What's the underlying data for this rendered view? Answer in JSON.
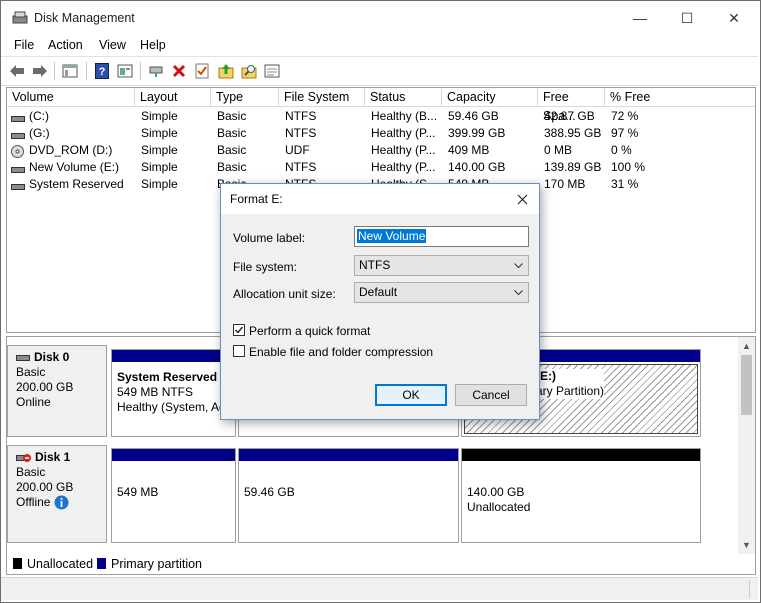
{
  "window": {
    "title": "Disk Management",
    "controls": {
      "minimize": "—",
      "maximize": "☐",
      "close": "✕"
    }
  },
  "menu": [
    "File",
    "Action",
    "View",
    "Help"
  ],
  "toolbar": {
    "icons": [
      "back-icon",
      "forward-icon",
      "console-tree-icon",
      "help-icon",
      "properties-icon",
      "connect-icon",
      "delete-icon",
      "check-icon",
      "open-folder-icon",
      "explore-icon",
      "rescan-icon"
    ]
  },
  "volume_list": {
    "columns": [
      "Volume",
      "Layout",
      "Type",
      "File System",
      "Status",
      "Capacity",
      "Free Spa...",
      "% Free"
    ],
    "rows": [
      {
        "volume": "(C:)",
        "layout": "Simple",
        "type": "Basic",
        "fs": "NTFS",
        "status": "Healthy (B...",
        "capacity": "59.46 GB",
        "free": "42.87 GB",
        "pct": "72 %",
        "icon": "drive-icon"
      },
      {
        "volume": "(G:)",
        "layout": "Simple",
        "type": "Basic",
        "fs": "NTFS",
        "status": "Healthy (P...",
        "capacity": "399.99 GB",
        "free": "388.95 GB",
        "pct": "97 %",
        "icon": "drive-icon"
      },
      {
        "volume": "DVD_ROM (D:)",
        "layout": "Simple",
        "type": "Basic",
        "fs": "UDF",
        "status": "Healthy (P...",
        "capacity": "409 MB",
        "free": "0 MB",
        "pct": "0 %",
        "icon": "dvd-icon"
      },
      {
        "volume": "New Volume (E:)",
        "layout": "Simple",
        "type": "Basic",
        "fs": "NTFS",
        "status": "Healthy (P...",
        "capacity": "140.00 GB",
        "free": "139.89 GB",
        "pct": "100 %",
        "icon": "drive-icon"
      },
      {
        "volume": "System Reserved",
        "layout": "Simple",
        "type": "Basic",
        "fs": "NTFS",
        "status": "Healthy (S...",
        "capacity": "549 MB",
        "free": "170 MB",
        "pct": "31 %",
        "icon": "drive-icon"
      }
    ]
  },
  "disks": [
    {
      "name": "Disk 0",
      "type": "Basic",
      "size": "200.00 GB",
      "state": "Online",
      "partitions": [
        {
          "title": "System Reserved",
          "line1": "549 MB NTFS",
          "line2": "Healthy (System, Ac"
        },
        {
          "title": "",
          "line1": "",
          "line2": ""
        },
        {
          "title": "(E:)",
          "line1": "",
          "line2": "ary Partition)"
        }
      ]
    },
    {
      "name": "Disk 1",
      "type": "Basic",
      "size": "200.00 GB",
      "state": "Offline",
      "partitions": [
        {
          "line1": "549 MB",
          "line2": ""
        },
        {
          "line1": "59.46 GB",
          "line2": ""
        },
        {
          "line1": "140.00 GB",
          "line2": "Unallocated"
        }
      ]
    }
  ],
  "legend": {
    "unallocated": "Unallocated",
    "primary": "Primary partition"
  },
  "colors": {
    "primary": "#00008b",
    "unallocated": "#000000",
    "selection": "#0078d7",
    "info": "#1e74c9",
    "error": "#c42b1c"
  },
  "dialog": {
    "title": "Format E:",
    "volume_label": "Volume label:",
    "volume_value": "New Volume",
    "fs_label": "File system:",
    "fs_value": "NTFS",
    "alloc_label": "Allocation unit size:",
    "alloc_value": "Default",
    "quick_format": "Perform a quick format",
    "quick_format_checked": true,
    "compression": "Enable file and folder compression",
    "compression_checked": false,
    "ok": "OK",
    "cancel": "Cancel"
  }
}
